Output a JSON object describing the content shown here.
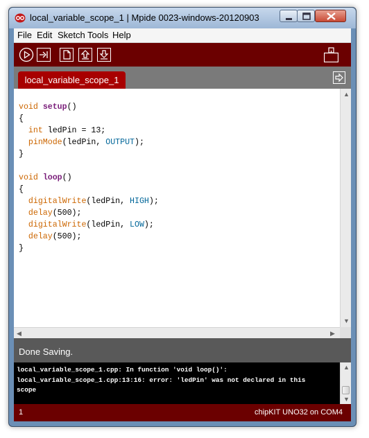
{
  "window": {
    "title": "local_variable_scope_1 | Mpide 0023-windows-20120903"
  },
  "menu": {
    "items": [
      "File",
      "Edit",
      "Sketch",
      "Tools",
      "Help"
    ]
  },
  "toolbar": {
    "buttons": [
      "verify-icon",
      "upload-icon",
      "new-icon",
      "open-icon",
      "save-icon",
      "serial-monitor-icon"
    ]
  },
  "tabs": {
    "active": "local_variable_scope_1"
  },
  "editor": {
    "lines": [
      "void setup()",
      "{",
      "  int ledPin = 13;",
      "  pinMode(ledPin, OUTPUT);",
      "}",
      "",
      "void loop()",
      "{",
      "  digitalWrite(ledPin, HIGH);",
      "  delay(500);",
      "  digitalWrite(ledPin, LOW);",
      "  delay(500);",
      "}"
    ]
  },
  "status": {
    "message": "Done Saving."
  },
  "console": {
    "lines": [
      "local_variable_scope_1.cpp: In function 'void loop()':",
      "local_variable_scope_1.cpp:13:16: error: 'ledPin' was not declared in this",
      "scope"
    ]
  },
  "footer": {
    "line_number": "1",
    "board": "chipKIT UNO32 on COM4"
  },
  "colors": {
    "toolbar": "#6b0000",
    "tab": "#a80000",
    "status": "#595959",
    "console": "#000000"
  }
}
